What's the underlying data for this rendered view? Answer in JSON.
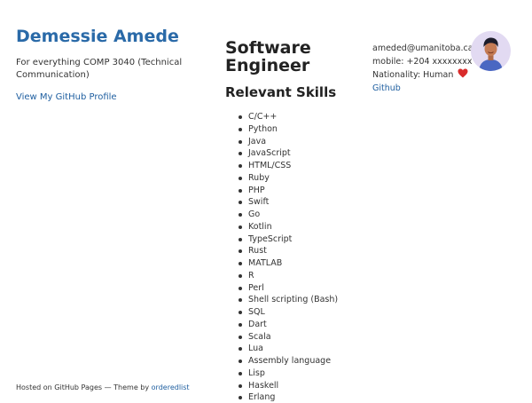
{
  "sidebar": {
    "name": "Demessie Amede",
    "description": "For everything COMP 3040 (Technical Communication)",
    "github_profile_link": "View My GitHub Profile",
    "footer": {
      "hosted_text": "Hosted on GitHub Pages — Theme by ",
      "theme_link": "orderedlist"
    }
  },
  "main": {
    "title": "Software Engineer",
    "skills_heading": "Relevant Skills",
    "skills": [
      "C/C++",
      "Python",
      "Java",
      "JavaScript",
      "HTML/CSS",
      "Ruby",
      "PHP",
      "Swift",
      "Go",
      "Kotlin",
      "TypeScript",
      "Rust",
      "MATLAB",
      "R",
      "Perl",
      "Shell scripting (Bash)",
      "SQL",
      "Dart",
      "Scala",
      "Lua",
      "Assembly language",
      "Lisp",
      "Haskell",
      "Erlang"
    ]
  },
  "contact": {
    "email": "ameded@umanitoba.ca",
    "mobile": "mobile: +204 xxxxxxxx",
    "nationality": "Nationality: Human",
    "github_link": "Github"
  },
  "icons": {
    "heart": "red-heart-icon",
    "avatar": "person-avatar-icon"
  },
  "colors": {
    "link": "#1f5fa0",
    "name": "#2a6aa8",
    "heart": "#d92b2b",
    "avatar_bg": "#e2daf2"
  }
}
